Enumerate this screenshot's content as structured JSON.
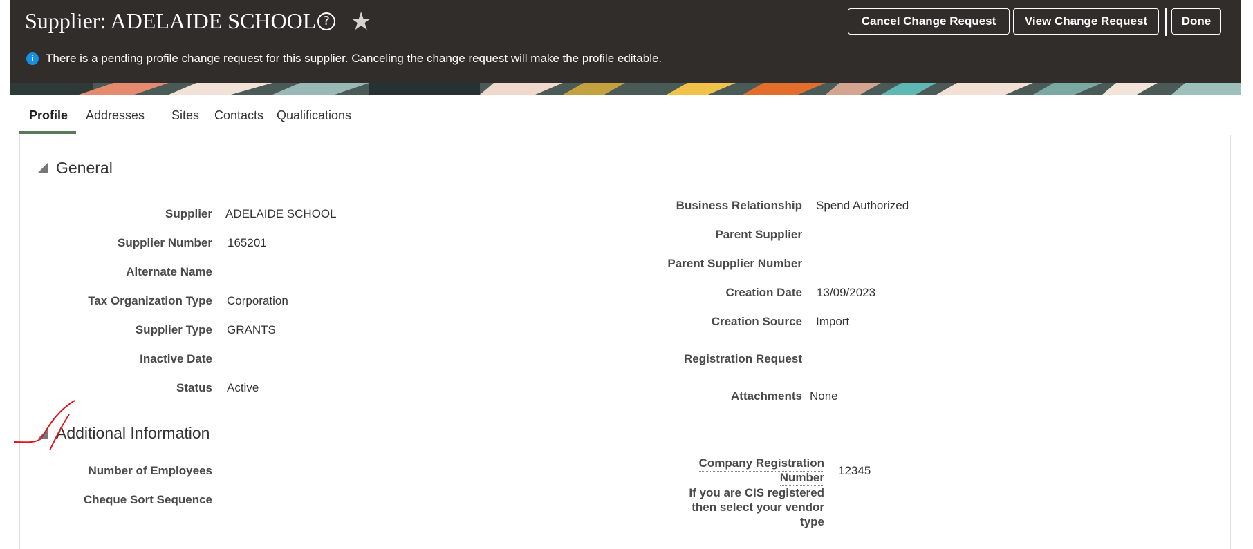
{
  "header": {
    "title": "Supplier: ADELAIDE SCHOOL",
    "help_icon": "?",
    "star_icon": "★",
    "buttons": {
      "cancel": "Cancel Change Request",
      "view": "View Change Request",
      "done": "Done"
    },
    "info_message": "There is a pending profile change request for this supplier. Canceling the change request will make the profile editable.",
    "info_icon": "i"
  },
  "tabs": [
    "Profile",
    "Addresses",
    "Sites",
    "Contacts",
    "Qualifications"
  ],
  "general": {
    "title": "General",
    "left": [
      {
        "label": "Supplier",
        "value": "ADELAIDE SCHOOL"
      },
      {
        "label": "Supplier Number",
        "value": "165201"
      },
      {
        "label": "Alternate Name",
        "value": ""
      },
      {
        "label": "Tax Organization Type",
        "value": "Corporation"
      },
      {
        "label": "Supplier Type",
        "value": "GRANTS"
      },
      {
        "label": "Inactive Date",
        "value": ""
      },
      {
        "label": "Status",
        "value": "Active"
      }
    ],
    "right": [
      {
        "label": "Business Relationship",
        "value": "Spend Authorized"
      },
      {
        "label": "Parent Supplier",
        "value": ""
      },
      {
        "label": "Parent Supplier Number",
        "value": ""
      },
      {
        "label": "Creation Date",
        "value": "13/09/2023"
      },
      {
        "label": "Creation Source",
        "value": "Import"
      },
      {
        "label": "Registration Request",
        "value": ""
      },
      {
        "label": "Attachments",
        "value": "None"
      }
    ]
  },
  "additional": {
    "title": "Additional Information",
    "left": [
      {
        "label": "Number of Employees",
        "value": ""
      },
      {
        "label": "Cheque Sort Sequence",
        "value": ""
      }
    ],
    "company_reg_label_1": "Company Registration",
    "company_reg_label_2": "Number",
    "company_reg_value": "12345",
    "cis_label": "If you are CIS registered then select your vendor type"
  },
  "colors": {
    "header_bg": "#312d2a",
    "active_tab_underline": "#5a7a5c",
    "info_icon": "#1a8fe0",
    "annotation_stroke": "#e0161d"
  }
}
